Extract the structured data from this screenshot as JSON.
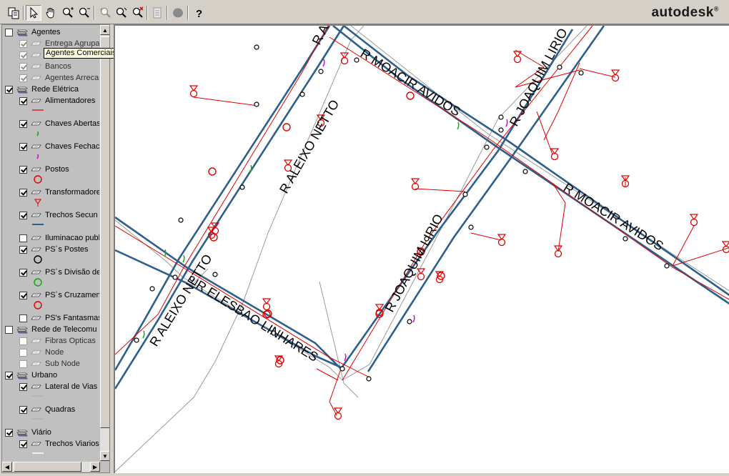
{
  "app": {
    "brand": "autodesk",
    "brand_mark": "®"
  },
  "toolbar": {
    "buttons": [
      {
        "id": "copy",
        "icon": "copy-icon"
      },
      {
        "id": "select",
        "icon": "arrow-pointer-icon",
        "pressed": true
      },
      {
        "id": "pan",
        "icon": "hand-pan-icon"
      },
      {
        "id": "zoom-in",
        "icon": "zoom-in-icon"
      },
      {
        "id": "zoom-out",
        "icon": "zoom-out-icon"
      },
      {
        "id": "zoom-previous",
        "icon": "zoom-previous-icon"
      },
      {
        "id": "zoom-window",
        "icon": "zoom-window-icon"
      },
      {
        "id": "zoom-clear",
        "icon": "zoom-clear-icon"
      },
      {
        "id": "report",
        "icon": "report-icon"
      },
      {
        "id": "stop",
        "icon": "stop-icon"
      },
      {
        "id": "help",
        "icon": "help-icon"
      }
    ]
  },
  "legend": {
    "tooltip": "Agentes Comerciais",
    "items": [
      {
        "label": "Agentes",
        "type": "group",
        "checked": false,
        "enabled": true
      },
      {
        "label": "Entrega Agrupa",
        "type": "layer",
        "checked": true,
        "enabled": false
      },
      {
        "label": "Agentes Comerciais",
        "type": "layer",
        "checked": true,
        "enabled": false
      },
      {
        "label": "Bancos",
        "type": "layer",
        "checked": true,
        "enabled": false
      },
      {
        "label": "Agentes Arreca",
        "type": "layer",
        "checked": true,
        "enabled": false
      },
      {
        "label": "Rede Elétrica",
        "type": "group",
        "checked": true,
        "enabled": true
      },
      {
        "label": "Alimentadores",
        "type": "layer",
        "checked": true,
        "enabled": true,
        "symbol": "red-line"
      },
      {
        "label": "Chaves Abertas",
        "type": "layer",
        "checked": true,
        "enabled": true,
        "symbol": "green-tick"
      },
      {
        "label": "Chaves Fechac",
        "type": "layer",
        "checked": true,
        "enabled": true,
        "symbol": "magenta-tick"
      },
      {
        "label": "Postos",
        "type": "layer",
        "checked": true,
        "enabled": true,
        "symbol": "red-circle"
      },
      {
        "label": "Transformadore",
        "type": "layer",
        "checked": true,
        "enabled": true,
        "symbol": "red-triangle"
      },
      {
        "label": "Trechos Secun",
        "type": "layer",
        "checked": true,
        "enabled": true,
        "symbol": "blue-line"
      },
      {
        "label": "Iluminacao publ",
        "type": "layer",
        "checked": false,
        "enabled": true
      },
      {
        "label": "PS´s Postes",
        "type": "layer",
        "checked": true,
        "enabled": true,
        "symbol": "black-circle"
      },
      {
        "label": "PS´s Divisão de",
        "type": "layer",
        "checked": true,
        "enabled": true,
        "symbol": "green-circle"
      },
      {
        "label": "PS´s Cruzament",
        "type": "layer",
        "checked": true,
        "enabled": true,
        "symbol": "red-circle"
      },
      {
        "label": "PS's Fantasmas",
        "type": "layer",
        "checked": false,
        "enabled": true
      },
      {
        "label": "Rede de Telecomu",
        "type": "group",
        "checked": false,
        "enabled": true
      },
      {
        "label": "Fibras Opticas",
        "type": "layer",
        "checked": false,
        "enabled": false
      },
      {
        "label": "Node",
        "type": "layer",
        "checked": false,
        "enabled": false
      },
      {
        "label": "Sub Node",
        "type": "layer",
        "checked": false,
        "enabled": false
      },
      {
        "label": "Urbano",
        "type": "group",
        "checked": true,
        "enabled": true
      },
      {
        "label": "Lateral de Vias",
        "type": "layer",
        "checked": true,
        "enabled": true,
        "symbol": "gray-line"
      },
      {
        "label": "Quadras",
        "type": "layer",
        "checked": true,
        "enabled": true,
        "symbol": "gray-line"
      },
      {
        "label": "Viário",
        "type": "group",
        "checked": true,
        "enabled": true
      },
      {
        "label": "Trechos Viarios",
        "type": "layer",
        "checked": true,
        "enabled": true,
        "symbol": "white-line"
      }
    ]
  },
  "map": {
    "street_labels": [
      "R ALEIXO NETTO",
      "R ALEIXO NETTO",
      "R ALEIXO NETTO",
      "R MOACIR AVIDOS",
      "R MOACIR AVIDOS",
      "R JOAQUIM LIRIO",
      "R JOAQUIM LIRIO",
      "R ELESBAO LINHARES"
    ],
    "colors": {
      "street_line": "#2e5f8a",
      "network": "#e00000",
      "block": "#9a9a9a"
    }
  }
}
